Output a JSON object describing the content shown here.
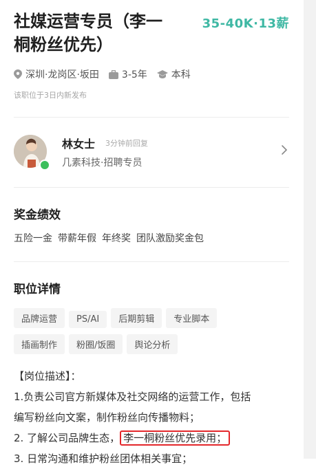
{
  "job": {
    "title_line1": "社媒运营专员（李一",
    "title_line2": "桐粉丝优先）",
    "salary": "35-40K·13薪",
    "location": "深圳·龙岗区·坂田",
    "experience": "3-5年",
    "education": "本科",
    "posted": "该职位于3日内新发布"
  },
  "recruiter": {
    "name": "林女士",
    "status": "3分钟前回复",
    "company": "几素科技·招聘专员"
  },
  "benefits": {
    "title": "奖金绩效",
    "items": [
      "五险一金",
      "带薪年假",
      "年终奖",
      "团队激励奖金包"
    ]
  },
  "details": {
    "title": "职位详情",
    "tags": [
      "品牌运营",
      "PS/AI",
      "后期剪辑",
      "专业脚本",
      "插画制作",
      "粉圈/饭圈",
      "舆论分析"
    ],
    "desc_header": "【岗位描述】：",
    "line1": "1.负责公司官方新媒体及社交网络的运营工作，包括",
    "line2": "编写粉丝向文案，制作粉丝向传播物料；",
    "line3_prefix": "2.  了解公司品牌生态，",
    "line3_highlight": "李一桐粉丝优先录用；",
    "line4": "3.  日常沟通和维护粉丝团体相关事宜；"
  },
  "colors": {
    "accent": "#3fb8a4",
    "highlight_border": "#e3262a",
    "online": "#3cbf5c"
  }
}
